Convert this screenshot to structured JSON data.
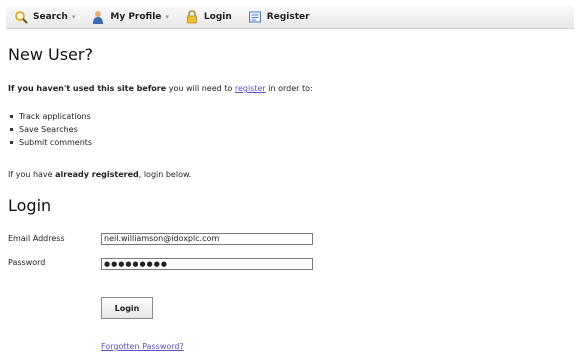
{
  "toolbar": {
    "items": [
      {
        "label": "Search",
        "icon": "search-icon",
        "has_menu": true
      },
      {
        "label": "My Profile",
        "icon": "user-icon",
        "has_menu": true
      },
      {
        "label": "Login",
        "icon": "lock-icon",
        "has_menu": false
      },
      {
        "label": "Register",
        "icon": "register-form-icon",
        "has_menu": false
      }
    ],
    "caret": "▾"
  },
  "new_user": {
    "title": "New User?",
    "intro_bold": "If you haven't used this site before",
    "intro_mid": " you will need to ",
    "intro_link": "register",
    "intro_end": " in order to:",
    "benefits": [
      "Track applications",
      "Save Searches",
      "Submit comments"
    ],
    "already_prefix": "If you have ",
    "already_bold": "already registered",
    "already_suffix": ", login below."
  },
  "login": {
    "title": "Login",
    "email_label": "Email Address",
    "email_value": "neil.williamson@idoxplc.com",
    "password_label": "Password",
    "password_mask": "●●●●●●●●●",
    "button_label": "Login",
    "forgot_link": "Forgotten Password?"
  },
  "colors": {
    "link": "#5d4ec4",
    "toolbar_bg": "#eeeeee"
  }
}
